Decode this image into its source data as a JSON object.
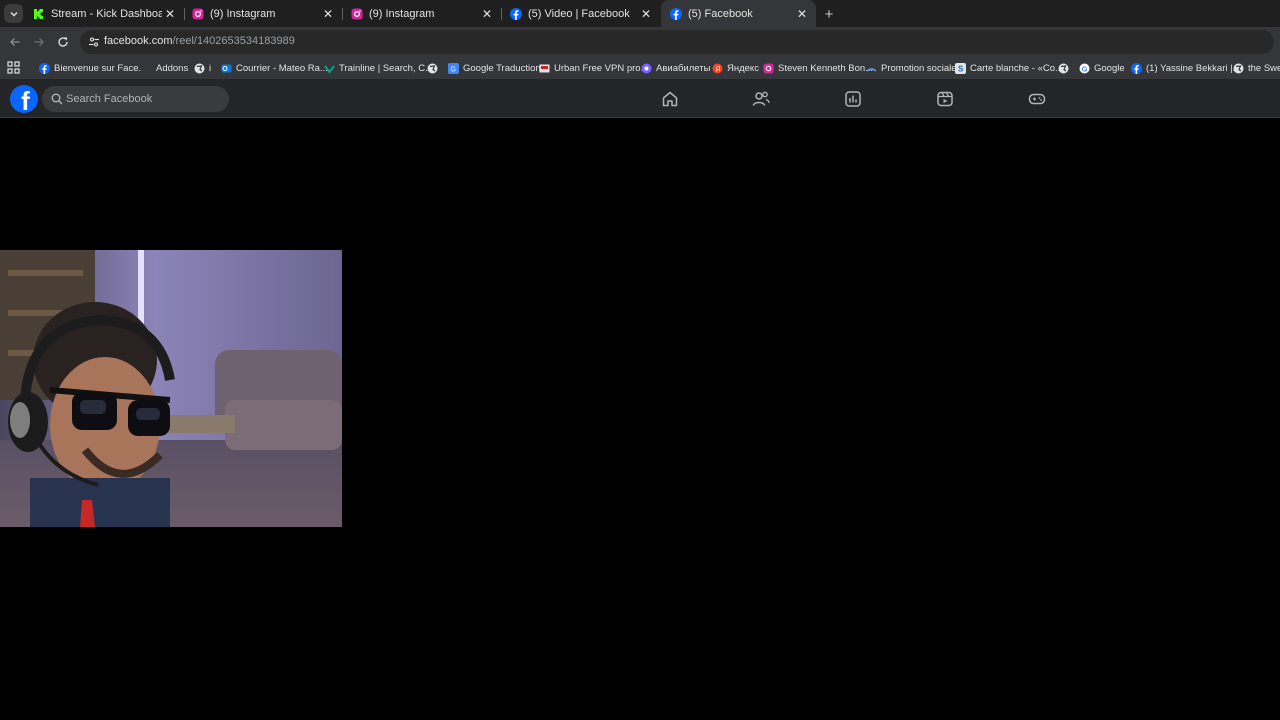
{
  "tabs": [
    {
      "title": "Stream - Kick Dashboard",
      "icon": "kick-icon",
      "active": false
    },
    {
      "title": "(9) Instagram",
      "icon": "instagram-icon",
      "active": false
    },
    {
      "title": "(9) Instagram",
      "icon": "instagram-icon",
      "active": false
    },
    {
      "title": "(5) Video | Facebook",
      "icon": "facebook-icon",
      "active": false
    },
    {
      "title": "(5) Facebook",
      "icon": "facebook-icon",
      "active": true
    }
  ],
  "address_bar": {
    "host": "facebook.com",
    "path": "/reel/1402653534183989"
  },
  "bookmarks": [
    {
      "label": "Bienvenue sur Face...",
      "icon": "facebook-icon"
    },
    {
      "label": "Addons",
      "icon": "addons-icon"
    },
    {
      "label": "i",
      "icon": "globe-icon"
    },
    {
      "label": "Courrier - Mateo Ra...",
      "icon": "outlook-icon"
    },
    {
      "label": "Trainline | Search, C...",
      "icon": "trainline-icon"
    },
    {
      "label": "",
      "icon": "globe-icon"
    },
    {
      "label": "Google Traduction",
      "icon": "google-translate-icon"
    },
    {
      "label": "Urban Free VPN pro...",
      "icon": "vpn-icon"
    },
    {
      "label": "Авиабилеты",
      "icon": "aviasales-icon"
    },
    {
      "label": "Яндекс",
      "icon": "yandex-icon"
    },
    {
      "label": "Steven Kenneth Bon...",
      "icon": "instagram-icon"
    },
    {
      "label": "Promotion sociale",
      "icon": "promo-icon"
    },
    {
      "label": "Carte blanche - «Co...",
      "icon": "s-icon"
    },
    {
      "label": "",
      "icon": "globe-icon"
    },
    {
      "label": "Google",
      "icon": "google-icon"
    },
    {
      "label": "(1) Yassine Bekkari |...",
      "icon": "facebook-icon"
    },
    {
      "label": "the Swed",
      "icon": "globe-icon"
    }
  ],
  "facebook": {
    "search_placeholder": "Search Facebook",
    "nav": [
      "home-icon",
      "friends-icon",
      "feeds-icon",
      "video-icon",
      "gaming-icon"
    ]
  },
  "colors": {
    "fb_blue": "#0866ff",
    "header_bg": "#242526",
    "tab_strip_bg": "#1f1f1f",
    "toolbar_bg": "#35363a"
  }
}
